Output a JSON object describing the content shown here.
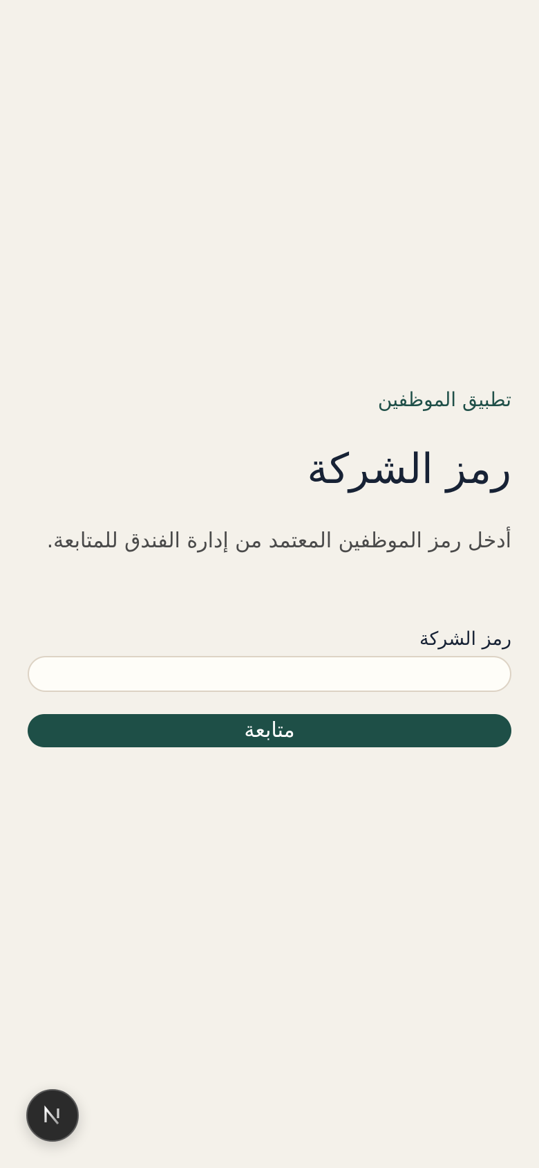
{
  "app": {
    "subtitle": "تطبيق الموظفين"
  },
  "page": {
    "title": "رمز الشركة",
    "description": "أدخل رمز الموظفين المعتمد من إدارة الفندق للمتابعة."
  },
  "form": {
    "code_label": "رمز الشركة",
    "code_value": "",
    "code_placeholder": "",
    "submit_label": "متابعة"
  },
  "dev_indicator": {
    "icon": "nextjs-logo-icon"
  },
  "colors": {
    "background": "#f4f1ea",
    "primary": "#1e4f47",
    "heading": "#172235",
    "input_background": "#fefdf8",
    "input_border": "#ddd3c5"
  }
}
